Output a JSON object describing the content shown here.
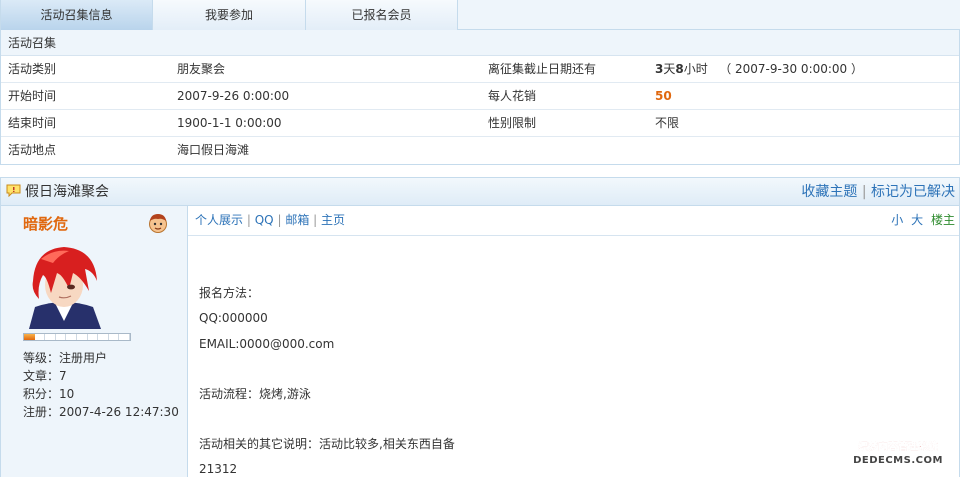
{
  "tabs": [
    {
      "label": "活动召集信息"
    },
    {
      "label": "我要参加"
    },
    {
      "label": "已报名会员"
    }
  ],
  "info": {
    "header": "活动召集",
    "rows": [
      {
        "label": "活动类别",
        "value": "朋友聚会",
        "label2": "离征集截止日期还有",
        "days": "3",
        "days_unit": "天",
        "hours": "8",
        "hours_unit": "小时",
        "deadline": "（ 2007-9-30 0:00:00 ）"
      },
      {
        "label": "开始时间",
        "value": "2007-9-26 0:00:00",
        "label2": "每人花销",
        "value2": "50"
      },
      {
        "label": "结束时间",
        "value": "1900-1-1 0:00:00",
        "label2": "性别限制",
        "value2": "不限"
      },
      {
        "label": "活动地点",
        "value": "海口假日海滩"
      }
    ]
  },
  "thread": {
    "title": "假日海滩聚会",
    "favorite_label": "收藏主题",
    "separator": "|",
    "resolved_label": "标记为已解决"
  },
  "author": {
    "name": "暗影危",
    "level_fraction": 0.1,
    "level_label": "等级：",
    "level_value": "注册用户",
    "posts_label": "文章：",
    "posts_value": "7",
    "points_label": "积分：",
    "points_value": "10",
    "reg_label": "注册：",
    "reg_value": "2007-4-26 12:47:30"
  },
  "post_links": {
    "profile": "个人展示",
    "qq": "QQ",
    "email": "邮箱",
    "home": "主页",
    "sep": "|"
  },
  "font_size": {
    "small": "小",
    "large": "大",
    "floor": "楼主"
  },
  "post_body": {
    "line1": "报名方法：",
    "line2": "QQ:000000",
    "line3": "EMAIL:0000@000.com",
    "line4": "活动流程：烧烤,游泳",
    "line5": "活动相关的其它说明：活动比较多,相关东西自备",
    "line6": "21312"
  },
  "watermark": {
    "line1": "织梦内容管理系统",
    "line2": "DEDECMS.COM"
  },
  "colors": {
    "accent": "#2d73b8",
    "highlight": "#e0680f",
    "border": "#c5dbec"
  }
}
